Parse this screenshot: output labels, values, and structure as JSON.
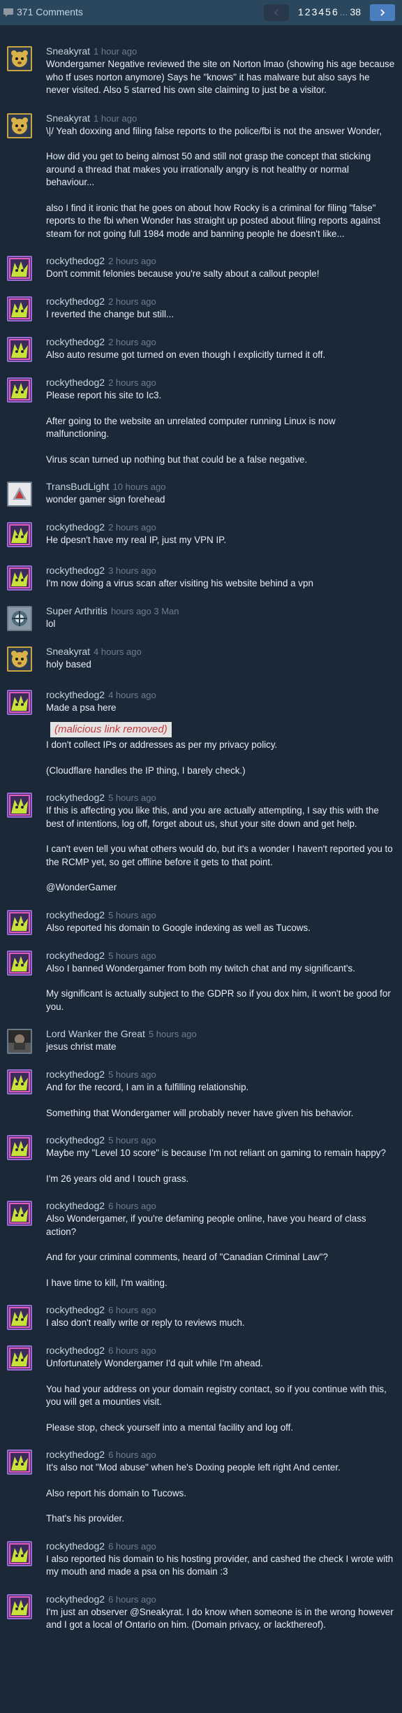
{
  "header": {
    "comment_count": "371 Comments",
    "pages": [
      "1",
      "2",
      "3",
      "4",
      "5",
      "6"
    ],
    "ellipsis": "...",
    "last_page": "38"
  },
  "comments": [
    {
      "author": "Sneakyrat",
      "time": "1 hour ago",
      "avatar": "rat",
      "paragraphs": [
        "Wondergamer Negative reviewed the site on Norton lmao (showing his age because who tf uses norton anymore) Says he \"knows\" it has malware but also says he never visited. Also 5 starred his own site claiming to just be a visitor."
      ]
    },
    {
      "author": "Sneakyrat",
      "time": "1 hour ago",
      "avatar": "rat",
      "paragraphs": [
        "\\|/ Yeah doxxing and filing false reports to the police/fbi is not the answer Wonder,",
        "How did you get to being almost 50 and still not grasp the concept that sticking around a thread that makes you irrationally angry is not healthy or normal behaviour...",
        "also I find it ironic that he goes on about how Rocky is a criminal for filing \"false\" reports to the fbi when Wonder has straight up posted about filing reports against steam for not going full 1984 mode and banning people he doesn't like..."
      ]
    },
    {
      "author": "rockythedog2",
      "time": "2 hours ago",
      "avatar": "dog",
      "paragraphs": [
        "Don't commit felonies because you're salty about a callout people!"
      ]
    },
    {
      "author": "rockythedog2",
      "time": "2 hours ago",
      "avatar": "dog",
      "paragraphs": [
        "I reverted the change but still..."
      ]
    },
    {
      "author": "rockythedog2",
      "time": "2 hours ago",
      "avatar": "dog",
      "paragraphs": [
        "Also auto resume got turned on even though I explicitly turned it off."
      ]
    },
    {
      "author": "rockythedog2",
      "time": "2 hours ago",
      "avatar": "dog",
      "paragraphs": [
        "Please report his site to Ic3.",
        "After going to the website an unrelated computer running Linux is now malfunctioning.",
        "Virus scan turned up nothing but that could be a false negative."
      ]
    },
    {
      "author": "TransBudLight",
      "time": "10 hours ago",
      "avatar": "bud",
      "paragraphs": [
        "wonder gamer sign forehead"
      ]
    },
    {
      "author": "rockythedog2",
      "time": "2 hours ago",
      "avatar": "dog",
      "paragraphs": [
        "He dpesn't have my real IP, just my VPN IP."
      ]
    },
    {
      "author": "rockythedog2",
      "time": "3 hours ago",
      "avatar": "dog",
      "paragraphs": [
        "I'm now doing a virus scan after visiting his website behind a vpn"
      ]
    },
    {
      "author": "Super Arthritis",
      "time": "hours ago 3 Man",
      "avatar": "arth",
      "paragraphs": [
        "lol"
      ]
    },
    {
      "author": "Sneakyrat",
      "time": "4 hours ago",
      "avatar": "rat",
      "paragraphs": [
        "holy based"
      ]
    },
    {
      "author": "rockythedog2",
      "time": "4 hours ago",
      "avatar": "dog",
      "paragraphs": [
        "Made a psa here"
      ],
      "removed": "(malicious link removed)",
      "after": [
        "I don't collect IPs or addresses as per my privacy policy.",
        "(Cloudflare handles the IP thing, I barely check.)"
      ]
    },
    {
      "author": "rockythedog2",
      "time": "5 hours ago",
      "avatar": "dog",
      "paragraphs": [
        "If this is affecting you like this, and you are actually attempting, I say this with the best of intentions, log off, forget about us, shut your site down and get help.",
        "I can't even tell you what others would do, but it's a wonder I haven't reported you to the RCMP yet, so get offline before it gets to that point.",
        "@WonderGamer"
      ]
    },
    {
      "author": "rockythedog2",
      "time": "5 hours ago",
      "avatar": "dog",
      "paragraphs": [
        "Also reported his domain to Google indexing as well as Tucows."
      ]
    },
    {
      "author": "rockythedog2",
      "time": "5 hours ago",
      "avatar": "dog",
      "paragraphs": [
        "Also I banned Wondergamer from both my twitch chat and my significant's.",
        "My significant is actually subject to the GDPR so if you dox him, it won't be good for you."
      ]
    },
    {
      "author": "Lord Wanker the Great",
      "time": "5 hours ago",
      "avatar": "lord",
      "paragraphs": [
        "jesus christ mate"
      ]
    },
    {
      "author": "rockythedog2",
      "time": "5 hours ago",
      "avatar": "dog",
      "paragraphs": [
        "And for the record, I am in a fulfilling relationship.",
        "Something that Wondergamer will probably never have given his behavior."
      ]
    },
    {
      "author": "rockythedog2",
      "time": "5 hours ago",
      "avatar": "dog",
      "paragraphs": [
        "Maybe my \"Level 10 score\" is because I'm not reliant on gaming to remain happy?",
        "I'm 26 years old and I touch grass."
      ]
    },
    {
      "author": "rockythedog2",
      "time": "6 hours ago",
      "avatar": "dog",
      "paragraphs": [
        "Also Wondergamer, if you're defaming people online, have you heard of class action?",
        "And for your criminal comments, heard of \"Canadian Criminal Law\"?",
        "I have time to kill, I'm waiting."
      ]
    },
    {
      "author": "rockythedog2",
      "time": "6 hours ago",
      "avatar": "dog",
      "paragraphs": [
        "I also don't really write or reply to reviews much."
      ]
    },
    {
      "author": "rockythedog2",
      "time": "6 hours ago",
      "avatar": "dog",
      "paragraphs": [
        "Unfortunately Wondergamer I'd quit while I'm ahead.",
        "You had your address on your domain registry contact, so if you continue with this, you will get a mounties visit.",
        "Please stop, check yourself into a mental facility and log off."
      ]
    },
    {
      "author": "rockythedog2",
      "time": "6 hours ago",
      "avatar": "dog",
      "paragraphs": [
        "It's also not \"Mod abuse\" when he's Doxing people left right And center.",
        "Also report his domain to Tucows.",
        "That's his provider."
      ]
    },
    {
      "author": "rockythedog2",
      "time": "6 hours ago",
      "avatar": "dog",
      "paragraphs": [
        "I also reported his domain to his hosting provider, and cashed the check I wrote with my mouth and made a psa on his domain :3"
      ]
    },
    {
      "author": "rockythedog2",
      "time": "6 hours ago",
      "avatar": "dog",
      "paragraphs": [
        "I'm just an observer @Sneakyrat. I do know when someone is in the wrong however and I got a local of Ontario on him. (Domain privacy, or lackthereof)."
      ]
    }
  ],
  "colors": {
    "background": "#1b2838",
    "header": "#2a475e",
    "accent": "#4a7fbf",
    "removed_text": "#c23b3b"
  }
}
